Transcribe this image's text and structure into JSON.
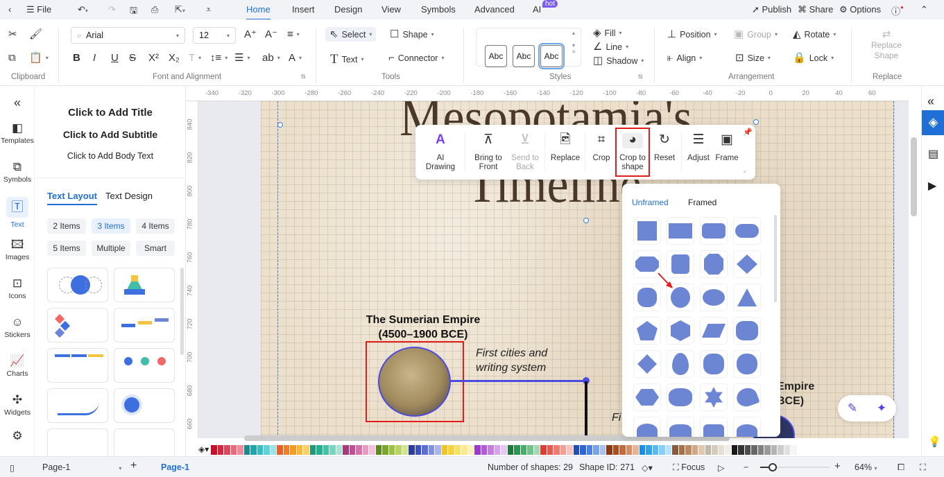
{
  "menubar": {
    "file": "File",
    "tabs": [
      "Home",
      "Insert",
      "Design",
      "View",
      "Symbols",
      "Advanced",
      "AI"
    ],
    "hot_badge": "hot",
    "publish": "Publish",
    "share": "Share",
    "options": "Options"
  },
  "ribbon": {
    "font": "Arial",
    "font_size": "12",
    "select": "Select",
    "shape": "Shape",
    "text": "Text",
    "connector": "Connector",
    "style_abc": [
      "Abc",
      "Abc",
      "Abc"
    ],
    "fill": "Fill",
    "line": "Line",
    "shadow": "Shadow",
    "position": "Position",
    "group": "Group",
    "rotate": "Rotate",
    "align": "Align",
    "size": "Size",
    "lock": "Lock",
    "replace_shape": "Replace Shape",
    "groups": {
      "clipboard": "Clipboard",
      "font": "Font and Alignment",
      "tools": "Tools",
      "styles": "Styles",
      "arrangement": "Arrangement",
      "replace": "Replace"
    }
  },
  "leftbar": {
    "items": [
      "Templates",
      "Symbols",
      "Text",
      "Images",
      "Icons",
      "Stickers",
      "Charts",
      "Widgets"
    ]
  },
  "panel": {
    "title": "Click to Add Title",
    "subtitle": "Click to Add Subtitle",
    "body": "Click to Add Body Text",
    "tabs": [
      "Text Layout",
      "Text Design"
    ],
    "chips": [
      "2 Items",
      "3 Items",
      "4 Items",
      "5 Items",
      "Multiple",
      "Smart"
    ]
  },
  "ruler": {
    "h": [
      -340,
      -320,
      -300,
      -280,
      -260,
      -240,
      -220,
      -200,
      -180,
      -160,
      -140,
      -120,
      -100,
      -80,
      -60,
      -40,
      -20,
      0,
      20,
      40,
      60
    ],
    "v": [
      840,
      820,
      800,
      780,
      760,
      740,
      720,
      700,
      680,
      660
    ]
  },
  "canvas": {
    "title1": "Mesopotamia's",
    "title2": "Timeline",
    "sumer_title": "The Sumerian Empire",
    "sumer_dates": "(4500–1900 BCE)",
    "sumer_desc1": "First cities and",
    "sumer_desc2": "writing system",
    "empire2a": "Empire",
    "empire2b": "BCE)",
    "partial": "Fi"
  },
  "float_toolbar": {
    "ai": "AI Drawing",
    "bring1": "Bring to",
    "bring2": "Front",
    "send1": "Send to",
    "send2": "Back",
    "replace": "Replace",
    "crop": "Crop",
    "cts1": "Crop to",
    "cts2": "shape",
    "reset": "Reset",
    "adjust": "Adjust",
    "frame": "Frame"
  },
  "shape_panel": {
    "tabs": [
      "Unframed",
      "Framed"
    ],
    "shapes": [
      "square",
      "rectangle",
      "rounded-rect",
      "pill",
      "octagon-wide",
      "rounded-square",
      "octagon",
      "diamond",
      "cross-rounded",
      "circle",
      "ellipse",
      "triangle",
      "pentagon",
      "hexagon",
      "parallelogram",
      "scalloped",
      "diamond-small",
      "egg",
      "badge",
      "flower",
      "hexagon-wide",
      "cloud",
      "star6",
      "heart",
      "arch1",
      "arch2",
      "arch3",
      "arch4"
    ]
  },
  "palette": [
    "#c8102e",
    "#d7263d",
    "#e0475b",
    "#ea6a7c",
    "#f28a9a",
    "#1b8a8f",
    "#21a5ac",
    "#35bfc6",
    "#5fd3d8",
    "#98e3e6",
    "#e8602c",
    "#f07d28",
    "#f59b21",
    "#f8b73a",
    "#fbd062",
    "#1a9a7a",
    "#23b08e",
    "#45c2a3",
    "#78d4bd",
    "#a8e4d3",
    "#a23c7c",
    "#c04e95",
    "#d971ad",
    "#e89ac5",
    "#f2c2dc",
    "#5c8a1e",
    "#78a82a",
    "#9ac23e",
    "#b8d460",
    "#d2e48e",
    "#2b3c9e",
    "#3c52c0",
    "#5a6ed4",
    "#8190e0",
    "#aab4ec",
    "#f2c51b",
    "#f6d43c",
    "#f8df66",
    "#fae98e",
    "#fcf2b8",
    "#9b3cc9",
    "#b35ad9",
    "#c77ce4",
    "#d9a2ee",
    "#e8c6f5",
    "#1e7a3c",
    "#2a9650",
    "#48ad69",
    "#72c28c",
    "#a2d8b2",
    "#e03c31",
    "#e8584e",
    "#ef7a72",
    "#f49e98",
    "#f8c2be",
    "#1f4fb8",
    "#2d66d4",
    "#4d83e0",
    "#7aa2ea",
    "#a6c2f2",
    "#8a3a14",
    "#a84e22",
    "#c46a3a",
    "#d88e64",
    "#e8b496",
    "#1d8de0",
    "#2fa4ee",
    "#56b9f2",
    "#86cff6",
    "#b6e2fa",
    "#8a5a3a",
    "#a6704a",
    "#bc8a64",
    "#d0a886",
    "#e2c8ae",
    "#c2b8a8",
    "#d4ccbe",
    "#e4ded4",
    "#f0ece6",
    "#1a1a1a",
    "#333333",
    "#4d4d4d",
    "#666666",
    "#808080",
    "#999999",
    "#b3b3b3",
    "#cccccc",
    "#e0e0e0",
    "#f5f5f5"
  ],
  "status": {
    "page_select": "Page-1",
    "page_tab": "Page-1",
    "shapes_count": "Number of shapes: 29",
    "shape_id": "Shape ID: 271",
    "focus": "Focus",
    "zoom": "64%"
  },
  "colors": {
    "accent": "#1f6fd6",
    "highlight": "#e21b1b",
    "shape": "#6c86d4"
  }
}
